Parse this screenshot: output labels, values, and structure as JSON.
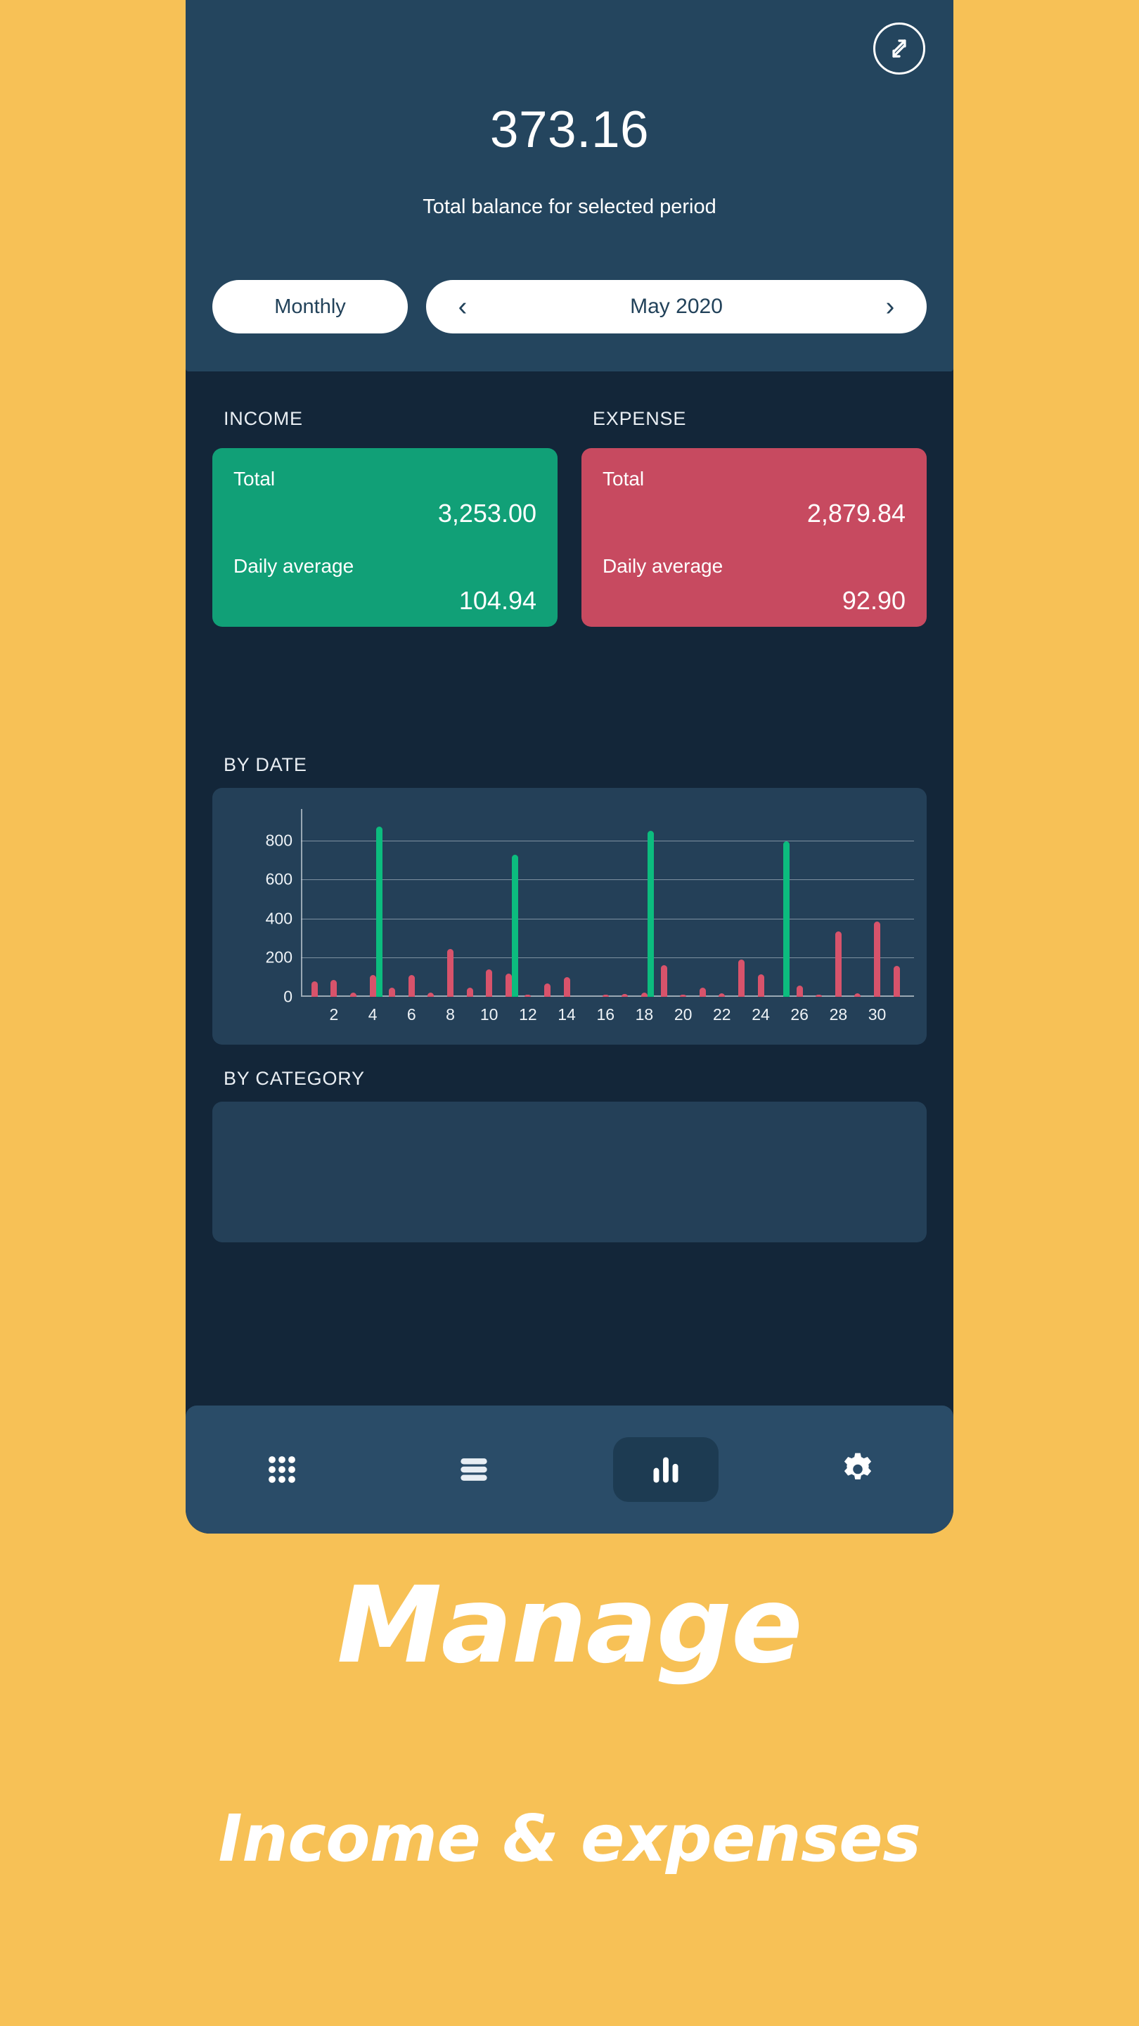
{
  "colors": {
    "page_background": "#f7c156",
    "header_dark": "#24455e",
    "body_dark": "#132639",
    "card_surface": "#244058",
    "navbar": "#2a4c68",
    "income_green": "#11a077",
    "expense_red": "#c74a60",
    "bar_income": "#0cbc7e",
    "bar_expense": "#d8536b",
    "text_light": "#ffffff"
  },
  "header": {
    "sync_icon": "transfer-arrows-icon",
    "balance_amount": "373.16",
    "balance_caption": "Total balance for selected period",
    "period_mode": "Monthly",
    "prev_arrow": "‹",
    "next_arrow": "›",
    "current_period": "May 2020"
  },
  "summary": {
    "income": {
      "heading": "INCOME",
      "total_label": "Total",
      "total_value": "3,253.00",
      "average_label": "Daily average",
      "average_value": "104.94"
    },
    "expense": {
      "heading": "EXPENSE",
      "total_label": "Total",
      "total_value": "2,879.84",
      "average_label": "Daily average",
      "average_value": "92.90"
    }
  },
  "by_date": {
    "heading": "BY DATE"
  },
  "by_category": {
    "heading": "BY CATEGORY"
  },
  "navbar": {
    "items": [
      {
        "name": "grid-dots-icon",
        "label": "Accounts",
        "active": false
      },
      {
        "name": "list-lines-icon",
        "label": "Records",
        "active": false
      },
      {
        "name": "bar-chart-icon",
        "label": "Analytics",
        "active": true
      },
      {
        "name": "gear-icon",
        "label": "Settings",
        "active": false
      }
    ]
  },
  "marketing": {
    "line1": "Manage",
    "line2": "Income & expenses"
  },
  "chart_data": {
    "type": "bar",
    "title": "BY DATE",
    "xlabel": "",
    "ylabel": "",
    "ylim": [
      0,
      960
    ],
    "grid": true,
    "legend": false,
    "yticks": [
      0,
      200,
      400,
      600,
      800
    ],
    "x": [
      1,
      2,
      3,
      4,
      5,
      6,
      7,
      8,
      9,
      10,
      11,
      12,
      13,
      14,
      15,
      16,
      17,
      18,
      19,
      20,
      21,
      22,
      23,
      24,
      25,
      26,
      27,
      28,
      29,
      30,
      31
    ],
    "xtick_labels": [
      "2",
      "4",
      "6",
      "8",
      "10",
      "12",
      "14",
      "16",
      "18",
      "20",
      "22",
      "24",
      "26",
      "28",
      "30"
    ],
    "xticks": [
      2,
      4,
      6,
      8,
      10,
      12,
      14,
      16,
      18,
      20,
      22,
      24,
      26,
      28,
      30
    ],
    "series": [
      {
        "name": "Income",
        "color": "#0cbc7e",
        "values": [
          0,
          0,
          0,
          870,
          0,
          0,
          0,
          0,
          0,
          0,
          725,
          0,
          0,
          0,
          0,
          0,
          0,
          850,
          0,
          0,
          0,
          0,
          0,
          0,
          795,
          0,
          0,
          0,
          0,
          0,
          0
        ]
      },
      {
        "name": "Expense",
        "color": "#d8536b",
        "values": [
          80,
          85,
          22,
          112,
          45,
          110,
          20,
          245,
          45,
          140,
          118,
          12,
          68,
          100,
          0,
          10,
          14,
          22,
          163,
          3,
          48,
          18,
          192,
          115,
          0,
          58,
          10,
          333,
          18,
          385,
          160
        ]
      }
    ]
  }
}
